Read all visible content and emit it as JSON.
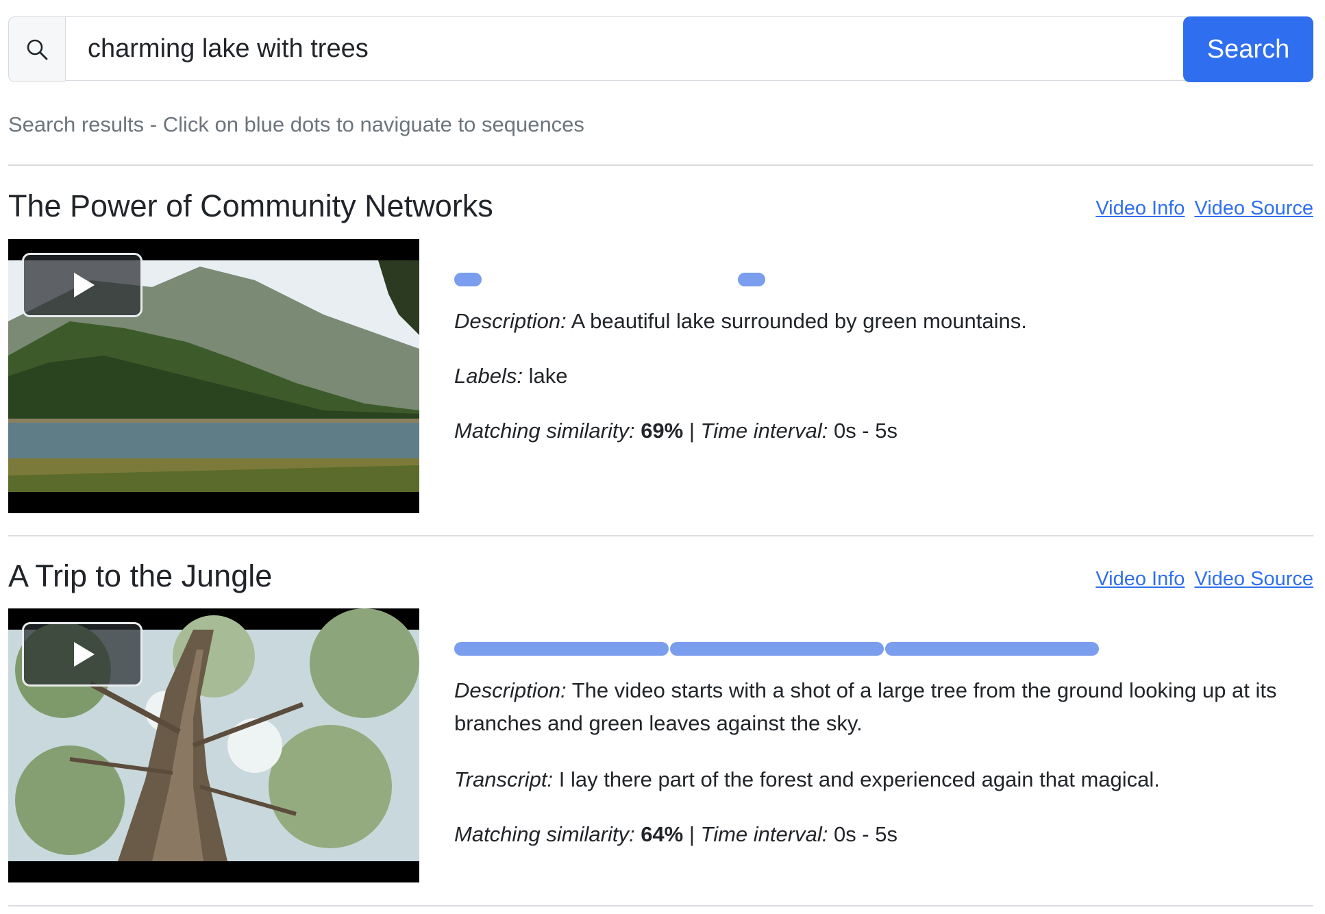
{
  "search": {
    "icon": "search-icon",
    "value": "charming lake with trees",
    "button_label": "Search",
    "accent": "#2f6fef"
  },
  "hint": "Search results - Click on blue dots to naviguate to sequences",
  "results": [
    {
      "title": "The Power of Community Networks",
      "video_info": "Video Info",
      "video_source": "Video Source",
      "thumbnail": "lake-with-mountains-thumbnail",
      "description_label": "Description:",
      "description": "A beautiful lake surrounded by green mountains.",
      "labels_label": "Labels:",
      "labels": "lake",
      "similarity_label": "Matching similarity:",
      "similarity": "69%",
      "separator": "|",
      "interval_label": "Time interval:",
      "interval": "0s - 5s"
    },
    {
      "title": "A Trip to the Jungle",
      "video_info": "Video Info",
      "video_source": "Video Source",
      "thumbnail": "tree-looking-up-thumbnail",
      "description_label": "Description:",
      "description": "The video starts with a shot of a large tree from the ground looking up at its branches and green leaves against the sky.",
      "transcript_label": "Transcript:",
      "transcript": "I lay there part of the forest and experienced again that magical.",
      "similarity_label": "Matching similarity:",
      "similarity": "64%",
      "separator": "|",
      "interval_label": "Time interval:",
      "interval": "0s - 5s"
    }
  ]
}
